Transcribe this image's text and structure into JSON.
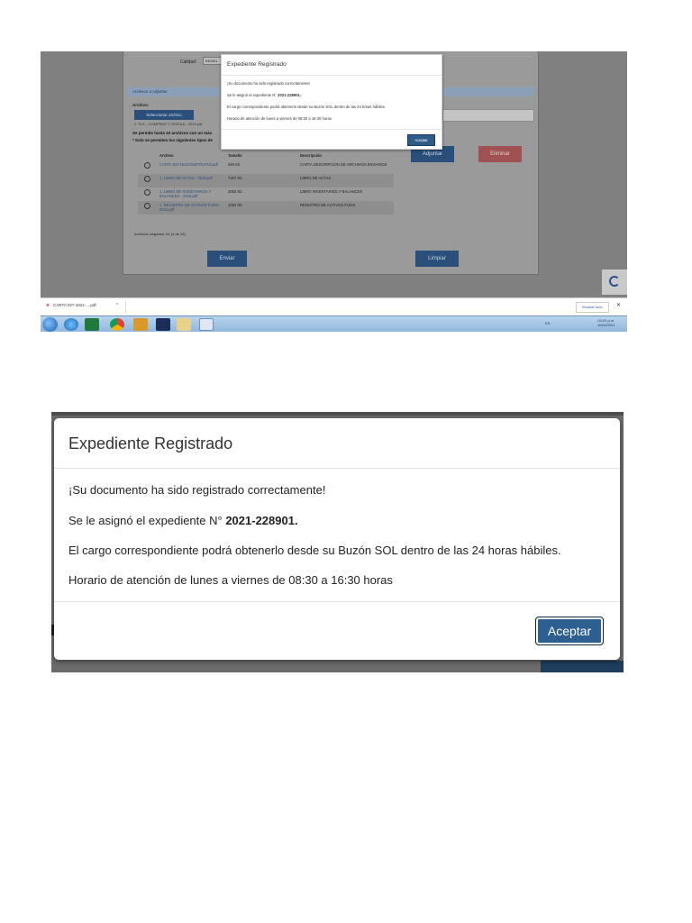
{
  "background_form": {
    "calidad_label": "Calidad:",
    "calidad_value": "940401",
    "section_title": "Archivos a Adjuntar",
    "archivo_label": "Archivo:",
    "select_button": "Seleccionar archivo",
    "file_line": "2. PLE - COMPRAS Y VENTAS - 2019.pdf",
    "note1": "Se permite hasta 10 archivos con un máx",
    "note2": "* Solo se permiten los siguientes tipos de",
    "adjuntar_button": "Adjuntar",
    "eliminar_button": "Eliminar",
    "table_headers": [
      "Archivo",
      "Tamaño",
      "Descripción"
    ],
    "rows": [
      {
        "file": "CARTA 027-RUCONSTRUTAS.pdf",
        "size": "494 Kb",
        "desc": "CARTA DESCRIPCION DE ARCHIVOS ENVIADOS"
      },
      {
        "file": "1. LIBRO DE ACTAS - 2019.pdf",
        "size": "7267 Kb",
        "desc": "LIBRO DE ACTAS"
      },
      {
        "file": "1. LIBRO DE INVENTARIOS Y BALANCES - 2019.pdf",
        "size": "3062 Kb",
        "desc": "LIBRO INVENTARIOS Y BALANCES"
      },
      {
        "file": "1. REGISTRO DE ACTIVOS FIJOS - 2019.pdf",
        "size": "1082 Kb",
        "desc": "REGISTRO DE ACTIVOS FIJOS"
      }
    ],
    "cargados": "Archivos cargados: 04 (4 de 10)",
    "enviar_button": "Enviar",
    "limpiar_button": "Limpiar"
  },
  "small_dialog": {
    "title": "Expediente Registrado",
    "line1": "¡Su documento ha sido registrado correctamente!",
    "line2_prefix": "Se le asignó el expediente N°",
    "expediente": "2021-228901.",
    "line3": "El cargo correspondiente podrá obtenerlo desde su Buzón SOL dentro de las 24 horas hábiles.",
    "line4": "Horario de atención de lunes a viernes de 08:30 a 16:30 horas",
    "ok_button": "Aceptar"
  },
  "download_bar": {
    "file": "CARTA 027-2021-....pdf",
    "show_all": "Mostrar todo"
  },
  "taskbar": {
    "lang": "ES",
    "time": "04:01 p.m.",
    "date": "11/02/2021"
  },
  "dialog": {
    "title": "Expediente Registrado",
    "line1": "¡Su documento ha sido registrado correctamente!",
    "line2_prefix": "Se le asignó el expediente N°",
    "expediente": "2021-228901.",
    "line3": "El cargo correspondiente podrá obtenerlo desde su Buzón SOL dentro de las 24 horas hábiles.",
    "line4": "Horario de atención de lunes a viernes de 08:30 a 16:30 horas",
    "ok_button": "Aceptar"
  },
  "colors": {
    "primary_button": "#2e5f91",
    "danger_button": "#a05252",
    "overlay": "#808080"
  }
}
